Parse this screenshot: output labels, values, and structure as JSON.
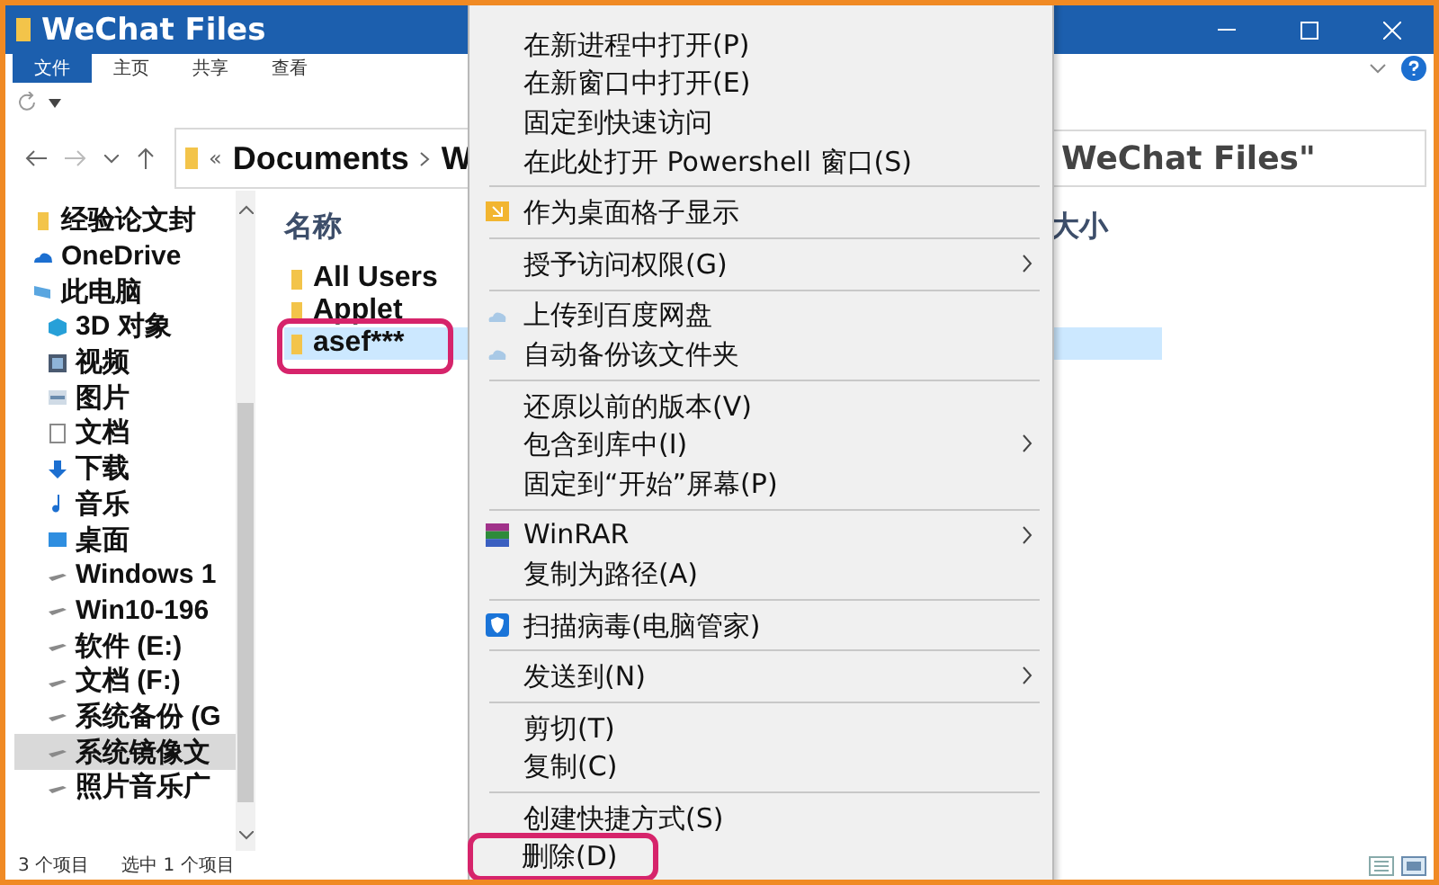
{
  "window": {
    "title": "WeChat Files"
  },
  "ribbon_tabs": [
    {
      "label": "文件",
      "selected": true
    },
    {
      "label": "主页",
      "selected": false
    },
    {
      "label": "共享",
      "selected": false
    },
    {
      "label": "查看",
      "selected": false
    }
  ],
  "address_bar": {
    "overflow": "«",
    "crumbs": [
      "Documents",
      "W"
    ],
    "search_field": {
      "placeholder": "WeChat Files\""
    }
  },
  "nav_pane": {
    "items": [
      {
        "label": "经验论文封",
        "kind": "folder",
        "selected": false
      },
      {
        "label": "OneDrive",
        "kind": "cloud",
        "selected": false
      },
      {
        "label": "此电脑",
        "kind": "computer",
        "selected": false,
        "children": [
          {
            "label": "3D 对象",
            "kind": "cube",
            "selected": false
          },
          {
            "label": "视频",
            "kind": "video",
            "selected": false
          },
          {
            "label": "图片",
            "kind": "image",
            "selected": false
          },
          {
            "label": "文档",
            "kind": "doc",
            "selected": false
          },
          {
            "label": "下载",
            "kind": "download",
            "selected": false
          },
          {
            "label": "音乐",
            "kind": "music",
            "selected": false
          },
          {
            "label": "桌面",
            "kind": "desktop",
            "selected": false
          },
          {
            "label": "Windows 1",
            "kind": "drive",
            "selected": false
          },
          {
            "label": "Win10-196",
            "kind": "drive",
            "selected": false
          },
          {
            "label": "软件 (E:)",
            "kind": "drive",
            "selected": false
          },
          {
            "label": "文档 (F:)",
            "kind": "drive",
            "selected": false
          },
          {
            "label": "系统备份 (G",
            "kind": "drive",
            "selected": false
          },
          {
            "label": "系统镜像文",
            "kind": "drive",
            "selected": true
          },
          {
            "label": "照片音乐广",
            "kind": "drive",
            "selected": false
          }
        ]
      }
    ]
  },
  "file_list": {
    "columns": [
      "名称",
      "大小"
    ],
    "rows": [
      {
        "name": "All Users",
        "selected": false,
        "highlighted": false
      },
      {
        "name": "Applet",
        "selected": false,
        "highlighted": false
      },
      {
        "name": "asef***",
        "selected": true,
        "highlighted": true
      }
    ]
  },
  "status_bar": [
    "3 个项目",
    "选中 1 个项目"
  ],
  "context_menu": [
    {
      "kind": "text",
      "label": "在新进程中打开(P)",
      "submenu": false,
      "highlighted": false
    },
    {
      "kind": "text",
      "label": "在新窗口中打开(E)",
      "submenu": false,
      "highlighted": false
    },
    {
      "kind": "text",
      "label": "固定到快速访问",
      "submenu": false,
      "highlighted": false
    },
    {
      "kind": "text",
      "label": "在此处打开 Powershell 窗口(S)",
      "submenu": false,
      "highlighted": false
    },
    {
      "kind": "separator"
    },
    {
      "kind": "grid",
      "label": "作为桌面格子显示",
      "submenu": false,
      "highlighted": false
    },
    {
      "kind": "separator"
    },
    {
      "kind": "text",
      "label": "授予访问权限(G)",
      "submenu": true,
      "highlighted": false
    },
    {
      "kind": "separator"
    },
    {
      "kind": "cloud",
      "label": "上传到百度网盘",
      "submenu": false,
      "highlighted": false
    },
    {
      "kind": "cloud",
      "label": "自动备份该文件夹",
      "submenu": false,
      "highlighted": false
    },
    {
      "kind": "separator"
    },
    {
      "kind": "text",
      "label": "还原以前的版本(V)",
      "submenu": false,
      "highlighted": false
    },
    {
      "kind": "text",
      "label": "包含到库中(I)",
      "submenu": true,
      "highlighted": false
    },
    {
      "kind": "text",
      "label": "固定到“开始”屏幕(P)",
      "submenu": false,
      "highlighted": false
    },
    {
      "kind": "separator"
    },
    {
      "kind": "archive",
      "label": "WinRAR",
      "submenu": true,
      "highlighted": false
    },
    {
      "kind": "text",
      "label": "复制为路径(A)",
      "submenu": false,
      "highlighted": false
    },
    {
      "kind": "separator"
    },
    {
      "kind": "shield",
      "label": "扫描病毒(电脑管家)",
      "submenu": false,
      "highlighted": false
    },
    {
      "kind": "separator"
    },
    {
      "kind": "text",
      "label": "发送到(N)",
      "submenu": true,
      "highlighted": false
    },
    {
      "kind": "separator"
    },
    {
      "kind": "text",
      "label": "剪切(T)",
      "submenu": false,
      "highlighted": false
    },
    {
      "kind": "text",
      "label": "复制(C)",
      "submenu": false,
      "highlighted": false
    },
    {
      "kind": "separator"
    },
    {
      "kind": "text",
      "label": "创建快捷方式(S)",
      "submenu": false,
      "highlighted": false
    },
    {
      "kind": "text",
      "label": "删除(D)",
      "submenu": false,
      "highlighted": true
    }
  ]
}
